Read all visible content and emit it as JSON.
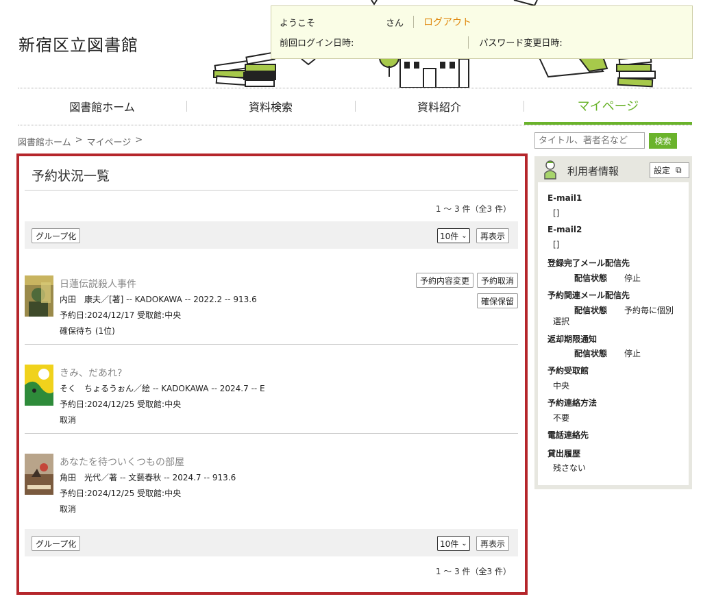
{
  "header": {
    "site_title": "新宿区立図書館",
    "welcome_label": "ようこそ",
    "san_label": "さん",
    "logout_label": "ログアウト",
    "last_login_label": "前回ログイン日時:",
    "password_changed_label": "パスワード変更日時:"
  },
  "nav": {
    "items": [
      {
        "label": "図書館ホーム"
      },
      {
        "label": "資料検索"
      },
      {
        "label": "資料紹介"
      },
      {
        "label": "マイページ"
      }
    ]
  },
  "breadcrumb": {
    "home": "図書館ホーム",
    "mypage": "マイページ",
    "sep": ">"
  },
  "search": {
    "placeholder": "タイトル、著者名など",
    "button_label": "検索"
  },
  "reservations": {
    "title": "予約状況一覧",
    "count_text": "1 ～ 3 件（全3 件）",
    "group_label": "グループ化",
    "per_page": "10件",
    "refresh_label": "再表示",
    "change_label": "予約内容変更",
    "cancel_label": "予約取消",
    "hold_label": "確保保留",
    "items": [
      {
        "title": "日蓮伝説殺人事件",
        "meta": "内田　康夫／[著] -- KADOKAWA -- 2022.2 -- 913.6",
        "reserve_info": "予約日:2024/12/17 受取館:中央",
        "status": "確保待ち (1位)"
      },
      {
        "title": "きみ、だあれ?",
        "meta": "そく　ちょるうぉん／絵 -- KADOKAWA -- 2024.7 -- E",
        "reserve_info": "予約日:2024/12/25 受取館:中央",
        "status": "取消"
      },
      {
        "title": "あなたを待ついくつもの部屋",
        "meta": "角田　光代／著 -- 文藝春秋 -- 2024.7 -- 913.6",
        "reserve_info": "予約日:2024/12/25 受取館:中央",
        "status": "取消"
      }
    ]
  },
  "sidebar": {
    "title": "利用者情報",
    "settings_label": "設定",
    "email1_label": "E-mail1",
    "email1_value": "[]",
    "email2_label": "E-mail2",
    "email2_value": "[]",
    "reg_mail_label": "登録完了メール配信先",
    "delivery_status_label": "配信状態",
    "reg_mail_status": "停止",
    "res_mail_label": "予約関連メール配信先",
    "res_mail_status": "予約毎に個別",
    "res_mail_status2": "選択",
    "return_notice_label": "返却期限通知",
    "return_notice_status": "停止",
    "pickup_label": "予約受取館",
    "pickup_value": "中央",
    "contact_method_label": "予約連絡方法",
    "contact_method_value": "不要",
    "phone_label": "電話連絡先",
    "history_label": "貸出履歴",
    "history_value": "残さない"
  }
}
